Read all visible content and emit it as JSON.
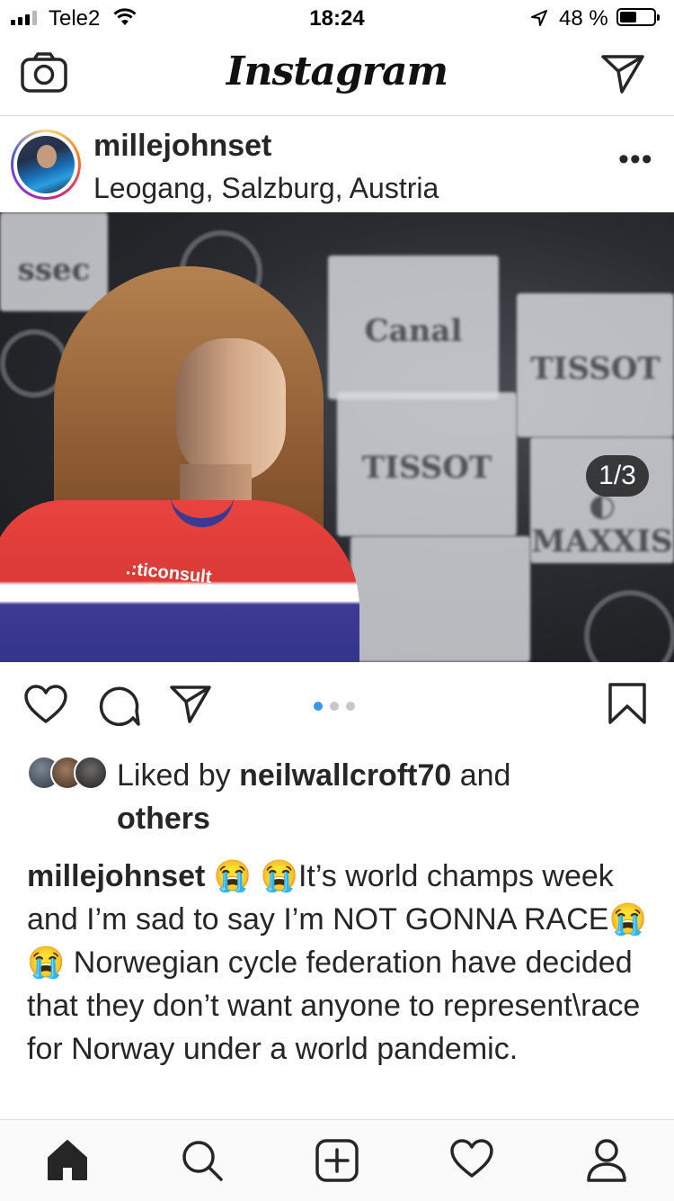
{
  "status_bar": {
    "carrier": "Tele2",
    "time": "18:24",
    "battery_percent": "48 %",
    "battery_level": 0.48
  },
  "header": {
    "logo": "Instagram",
    "camera_icon": "camera-icon",
    "direct_icon": "paper-plane-icon"
  },
  "post": {
    "username": "millejohnset",
    "location": "Leogang, Salzburg, Austria",
    "more_label": "•••",
    "media_counter": "1/3",
    "carousel_total": 3,
    "carousel_index": 1,
    "image_sponsor_text": ".:ticonsult"
  },
  "likes": {
    "prefix": "Liked by ",
    "user": "neilwallcroft70",
    "middle": " and",
    "suffix": "others"
  },
  "caption": {
    "username": "millejohnset",
    "part1": "😭 😭It’s world champs week and I’m sad to say I’m NOT GONNA RACE😭 😭 Norwegian cycle federation have decided that they don’t want anyone to represent\\race for Norway under a world pandemic."
  },
  "colors": {
    "accent_blue": "#3897f0",
    "text": "#262626",
    "divider": "#dbdbdb"
  },
  "tabs": [
    "home-icon",
    "search-icon",
    "new-post-icon",
    "activity-heart-icon",
    "profile-icon"
  ]
}
